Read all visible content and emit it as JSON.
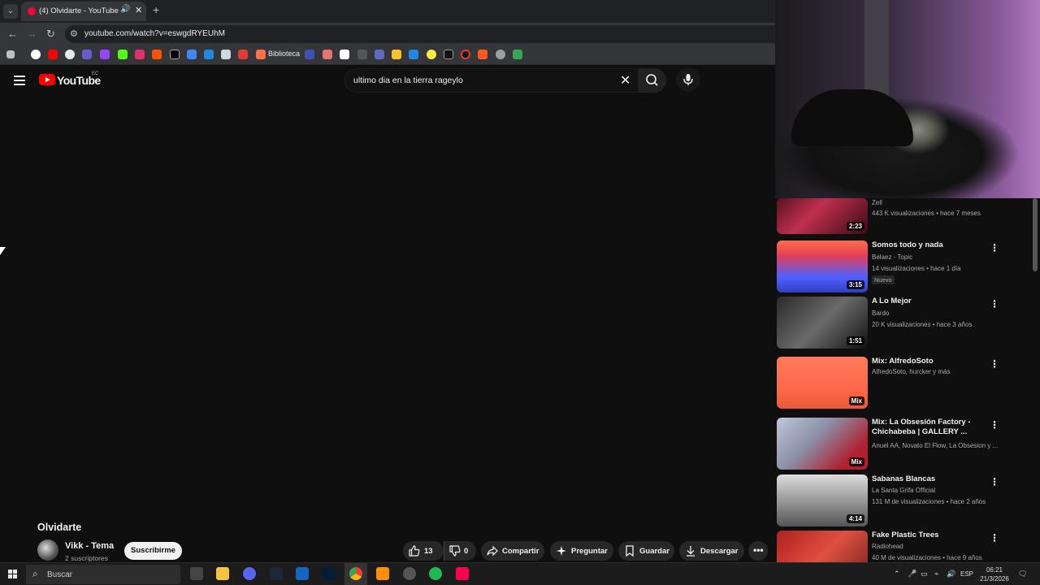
{
  "browser": {
    "tab_title": "(4) Olvidarte - YouTube",
    "url": "youtube.com/watch?v=eswgdRYEUhM",
    "bookmark_label": "Biblioteca"
  },
  "youtube": {
    "logo_text": "YouTube",
    "country_code": "EC",
    "search_query": "ultimo dia en la tierra rageylo"
  },
  "video": {
    "title": "Olvidarte",
    "channel_name": "Vikk - Tema",
    "subscribers": "2 suscriptores",
    "subscribe_label": "Suscribirme",
    "likes": "13",
    "dislikes": "0",
    "share_label": "Compartir",
    "ask_label": "Preguntar",
    "save_label": "Guardar",
    "download_label": "Descargar"
  },
  "sidebar": {
    "items": [
      {
        "title": "",
        "channel": "Zell",
        "meta": "443 K visualizaciones • hace 7 meses",
        "duration": "2:23",
        "badge": ""
      },
      {
        "title": "Somos todo y nada",
        "channel": "Belaez - Topic",
        "meta": "14 visualizaciones • hace 1 día",
        "duration": "3:15",
        "badge": "Nuevo"
      },
      {
        "title": "A Lo Mejor",
        "channel": "Bardo",
        "meta": "20 K visualizaciones • hace 3 años",
        "duration": "1:51",
        "badge": ""
      },
      {
        "title": "Mix: AlfredoSoto",
        "channel": "AlfredoSoto, hurcker y más",
        "meta": "",
        "duration": "Mix",
        "badge": ""
      },
      {
        "title": "Mix: La Obsesión Factory - Chichabeba | GALLERY ...",
        "channel": "Anuel AA, Novato El Flow, La Obsesion y ...",
        "meta": "",
        "duration": "Mix",
        "badge": ""
      },
      {
        "title": "Sabanas Blancas",
        "channel": "La Santa Grifa Official",
        "meta": "131 M de visualizaciones • hace 2 años",
        "duration": "4:14",
        "badge": ""
      },
      {
        "title": "Fake Plastic Trees",
        "channel": "Radiohead",
        "meta": "40 M de visualizaciones • hace 9 años",
        "duration": "",
        "badge": ""
      }
    ]
  },
  "taskbar": {
    "search_placeholder": "Buscar",
    "language": "ESP",
    "time": "06:21",
    "date": "21/3/2026"
  },
  "colors": {
    "yt_red": "#ff0000",
    "background": "#0f0f0f",
    "pill": "#272727"
  }
}
